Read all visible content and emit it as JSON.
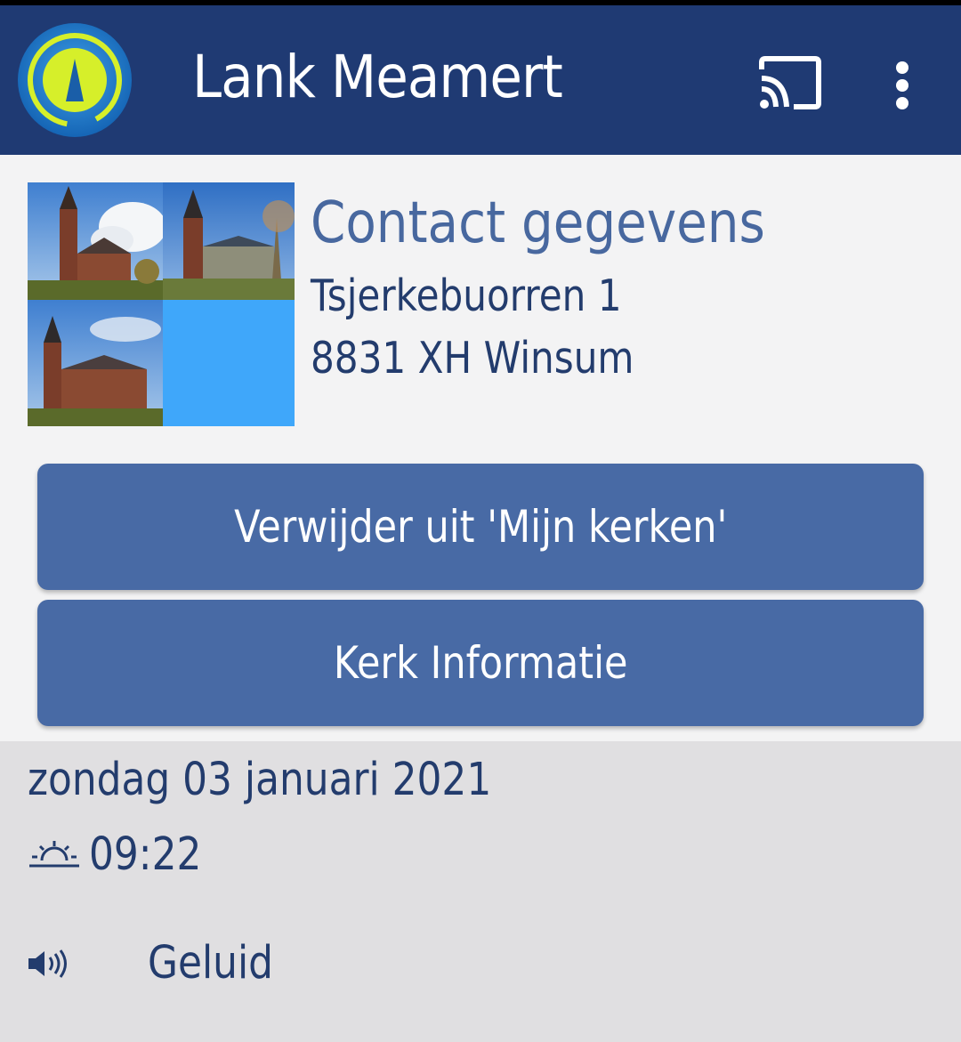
{
  "app_bar": {
    "title": "Lank Meamert",
    "logo_icon": "app-logo-icon",
    "cast_icon": "cast-icon",
    "menu_icon": "more-vert-icon",
    "background_color": "#1f3a73"
  },
  "contact": {
    "title": "Contact gegevens",
    "address_line1": "Tsjerkebuorren 1",
    "address_line2": "8831 XH Winsum"
  },
  "buttons": {
    "remove_label": "Verwijder uit 'Mijn kerken'",
    "info_label": "Kerk Informatie",
    "color": "#486aa5"
  },
  "service": {
    "date": "zondag 03 januari 2021",
    "time": "09:22",
    "time_icon": "sunrise-icon",
    "sound_icon": "speaker-icon",
    "sound_label": "Geluid"
  }
}
